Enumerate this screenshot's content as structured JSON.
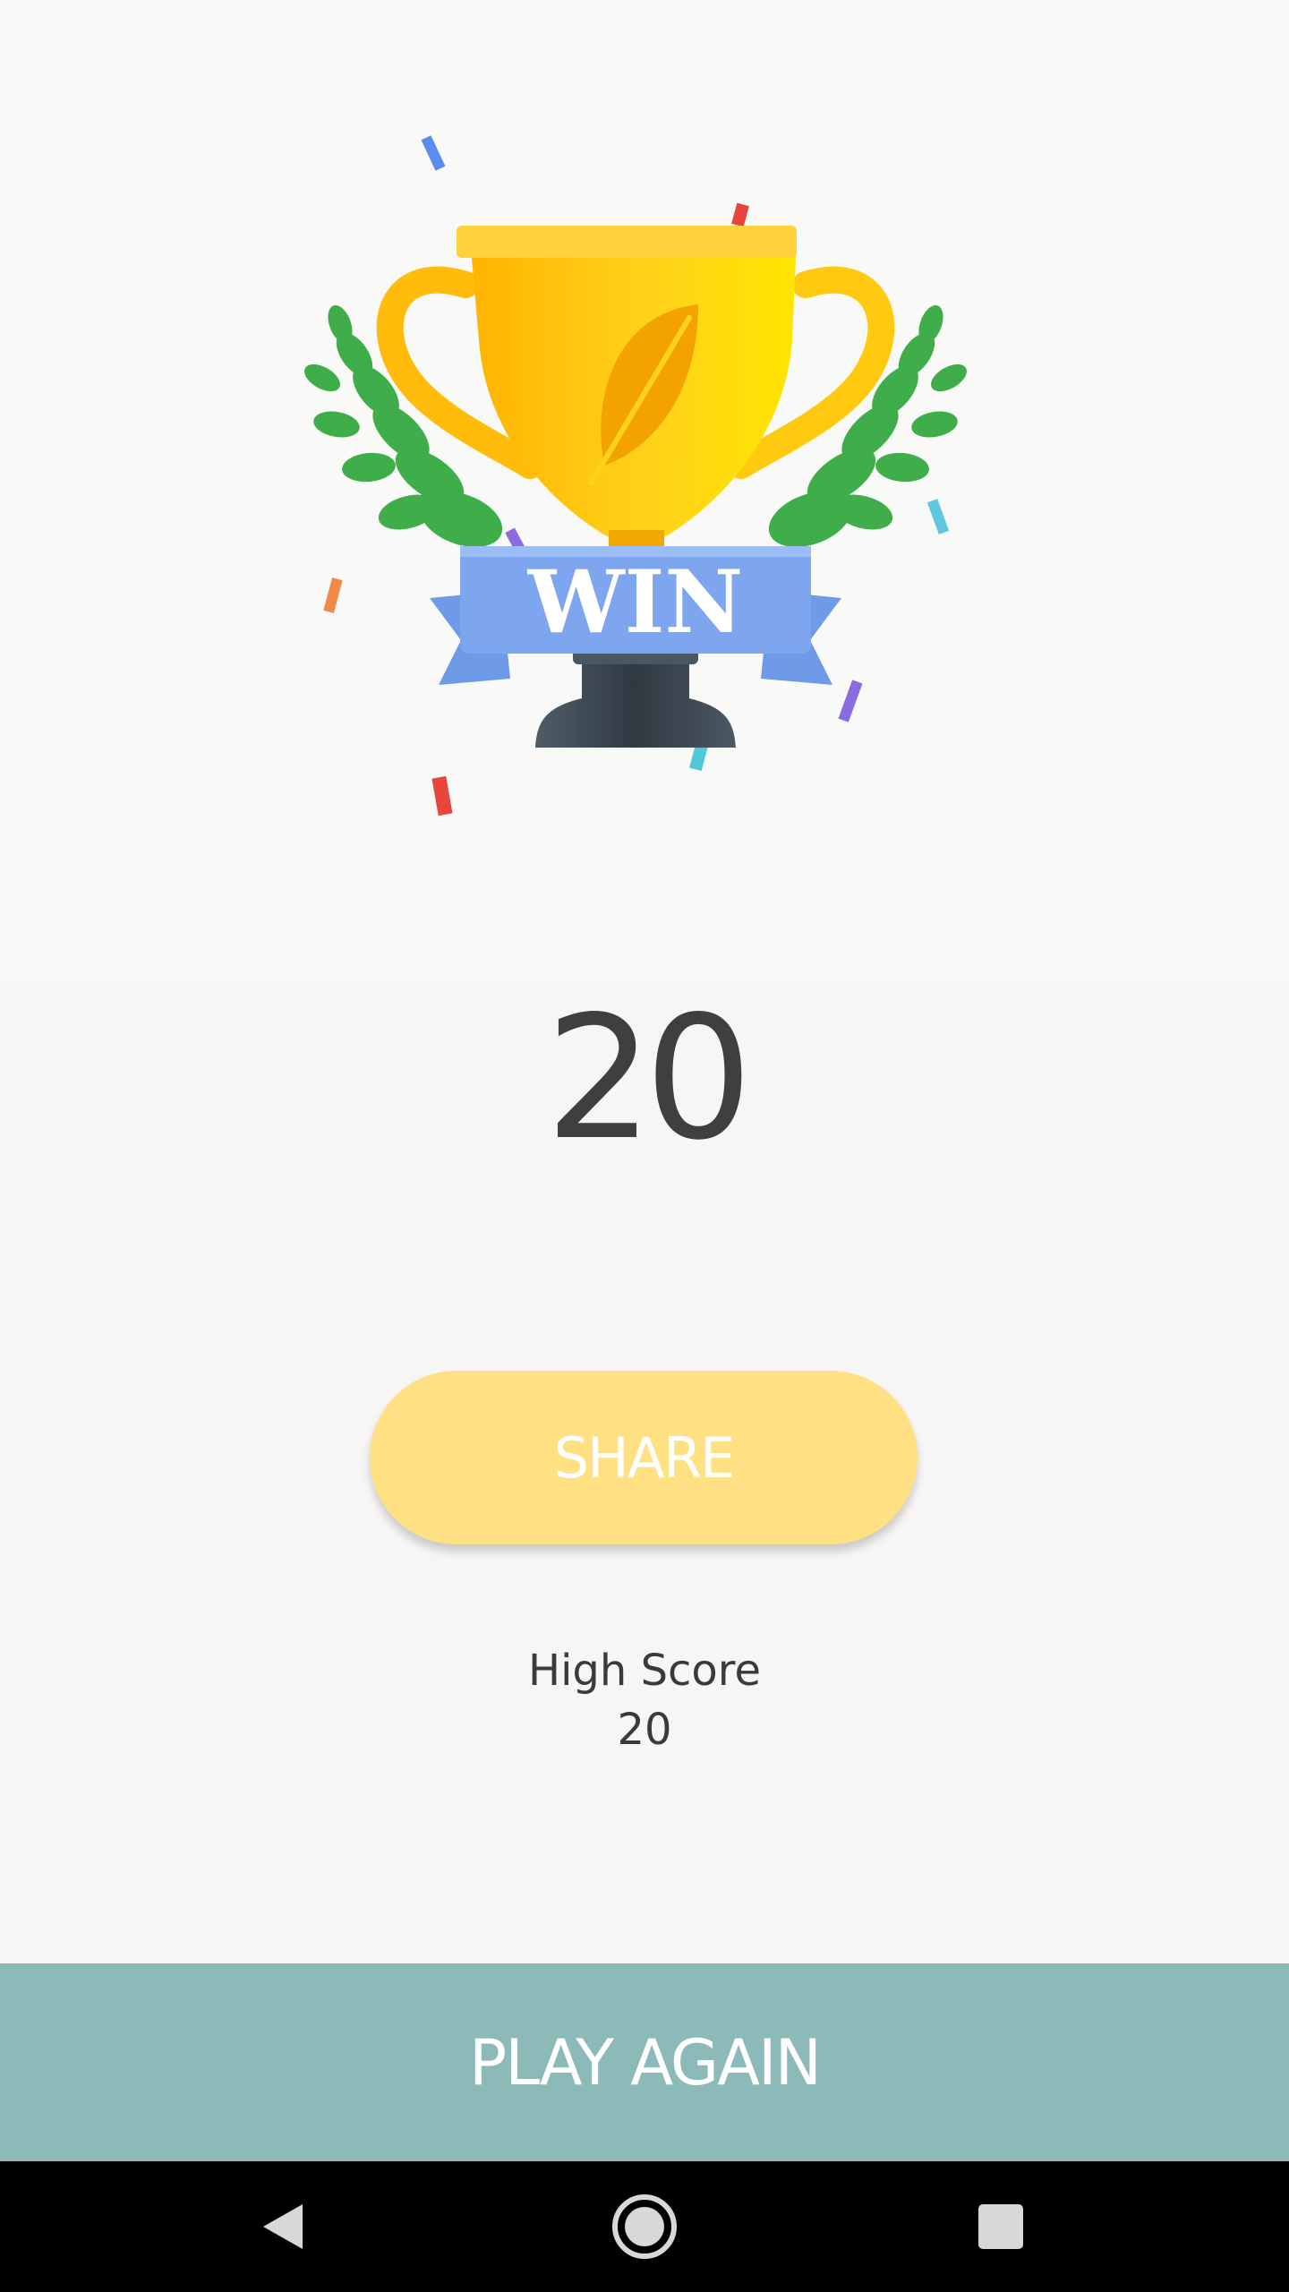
{
  "hero": {
    "trophy_banner_text": "WIN",
    "colors": {
      "cup": "#ffc20e",
      "banner": "#7ea6ef",
      "leaves": "#3fae4a",
      "base": "#3c4650"
    }
  },
  "score": {
    "value": "20"
  },
  "share": {
    "label": "SHARE",
    "color": "#ffe083"
  },
  "high_score": {
    "label": "High Score",
    "value": "20"
  },
  "play_again": {
    "label": "PLAY AGAIN",
    "color": "#8bbab8"
  },
  "nav": {
    "back_icon": "back-triangle-icon",
    "home_icon": "home-circle-icon",
    "recent_icon": "recents-square-icon"
  }
}
